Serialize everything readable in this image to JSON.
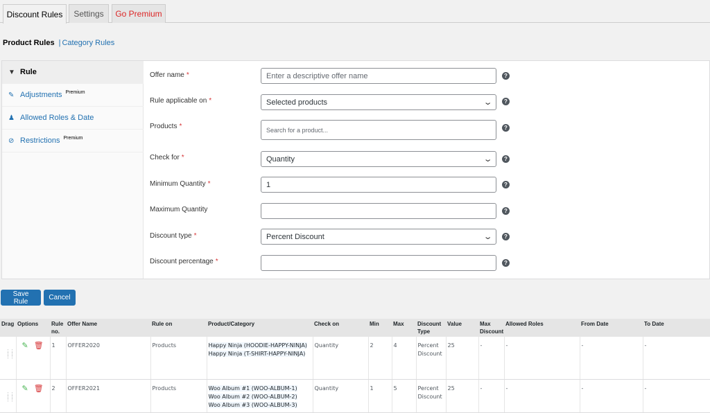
{
  "tabs": [
    {
      "label": "Discount Rules"
    },
    {
      "label": "Settings"
    },
    {
      "label": "Go Premium"
    }
  ],
  "subnav": {
    "current": "Product Rules",
    "separator": "|",
    "link": "Category Rules"
  },
  "sidebar": {
    "items": [
      {
        "label": "Rule",
        "icon": "filter-icon"
      },
      {
        "label": "Adjustments",
        "badge": "Premium",
        "icon": "pencil-icon"
      },
      {
        "label": "Allowed Roles & Date",
        "icon": "users-icon"
      },
      {
        "label": "Restrictions",
        "badge": "Premium",
        "icon": "block-icon"
      }
    ]
  },
  "form": {
    "offer_name": {
      "label": "Offer name",
      "required": "*",
      "value": "",
      "placeholder": "Enter a descriptive offer name"
    },
    "rule_applicable": {
      "label": "Rule applicable on",
      "required": "*",
      "value": "Selected products"
    },
    "products": {
      "label": "Products",
      "required": "*",
      "value": "",
      "placeholder": "Search for a product..."
    },
    "check_for": {
      "label": "Check for",
      "required": "*",
      "value": "Quantity"
    },
    "min_qty": {
      "label": "Minimum Quantity",
      "required": "*",
      "value": "1"
    },
    "max_qty": {
      "label": "Maximum Quantity",
      "value": ""
    },
    "discount_type": {
      "label": "Discount type",
      "required": "*",
      "value": "Percent Discount"
    },
    "discount_pct": {
      "label": "Discount percentage",
      "required": "*",
      "value": ""
    },
    "help_glyph": "?"
  },
  "buttons": {
    "save": "Save Rule",
    "cancel": "Cancel"
  },
  "table": {
    "headers": {
      "drag": "Drag",
      "options": "Options",
      "rule_no": "Rule no.",
      "offer_name": "Offer Name",
      "rule_on": "Rule on",
      "product": "Product/Category",
      "check_on": "Check on",
      "min": "Min",
      "max": "Max",
      "discount_type": "Discount Type",
      "value": "Value",
      "max_discount": "Max Discount",
      "allowed_roles": "Allowed Roles",
      "from_date": "From Date",
      "to_date": "To Date"
    },
    "rows": [
      {
        "rule_no": "1",
        "offer_name": "OFFER2020",
        "rule_on": "Products",
        "products": [
          "Happy Ninja (HOODIE-HAPPY-NINJA)",
          "Happy Ninja (T-SHIRT-HAPPY-NINJA)"
        ],
        "check_on": "Quantity",
        "min": "2",
        "max": "4",
        "discount_type": "Percent Discount",
        "value": "25",
        "max_discount": "-",
        "allowed_roles": "-",
        "from_date": "-",
        "to_date": "-"
      },
      {
        "rule_no": "2",
        "offer_name": "OFFER2021",
        "rule_on": "Products",
        "products": [
          "Woo Album #1 (WOO-ALBUM-1)",
          "Woo Album #2 (WOO-ALBUM-2)",
          "Woo Album #3 (WOO-ALBUM-3)"
        ],
        "check_on": "Quantity",
        "min": "1",
        "max": "5",
        "discount_type": "Percent Discount",
        "value": "25",
        "max_discount": "-",
        "allowed_roles": "-",
        "from_date": "-",
        "to_date": "-"
      }
    ]
  },
  "colors": {
    "primary": "#2271b1",
    "premium": "#dc2626",
    "required": "#d63638",
    "edit": "#46b450",
    "delete": "#d63638"
  }
}
